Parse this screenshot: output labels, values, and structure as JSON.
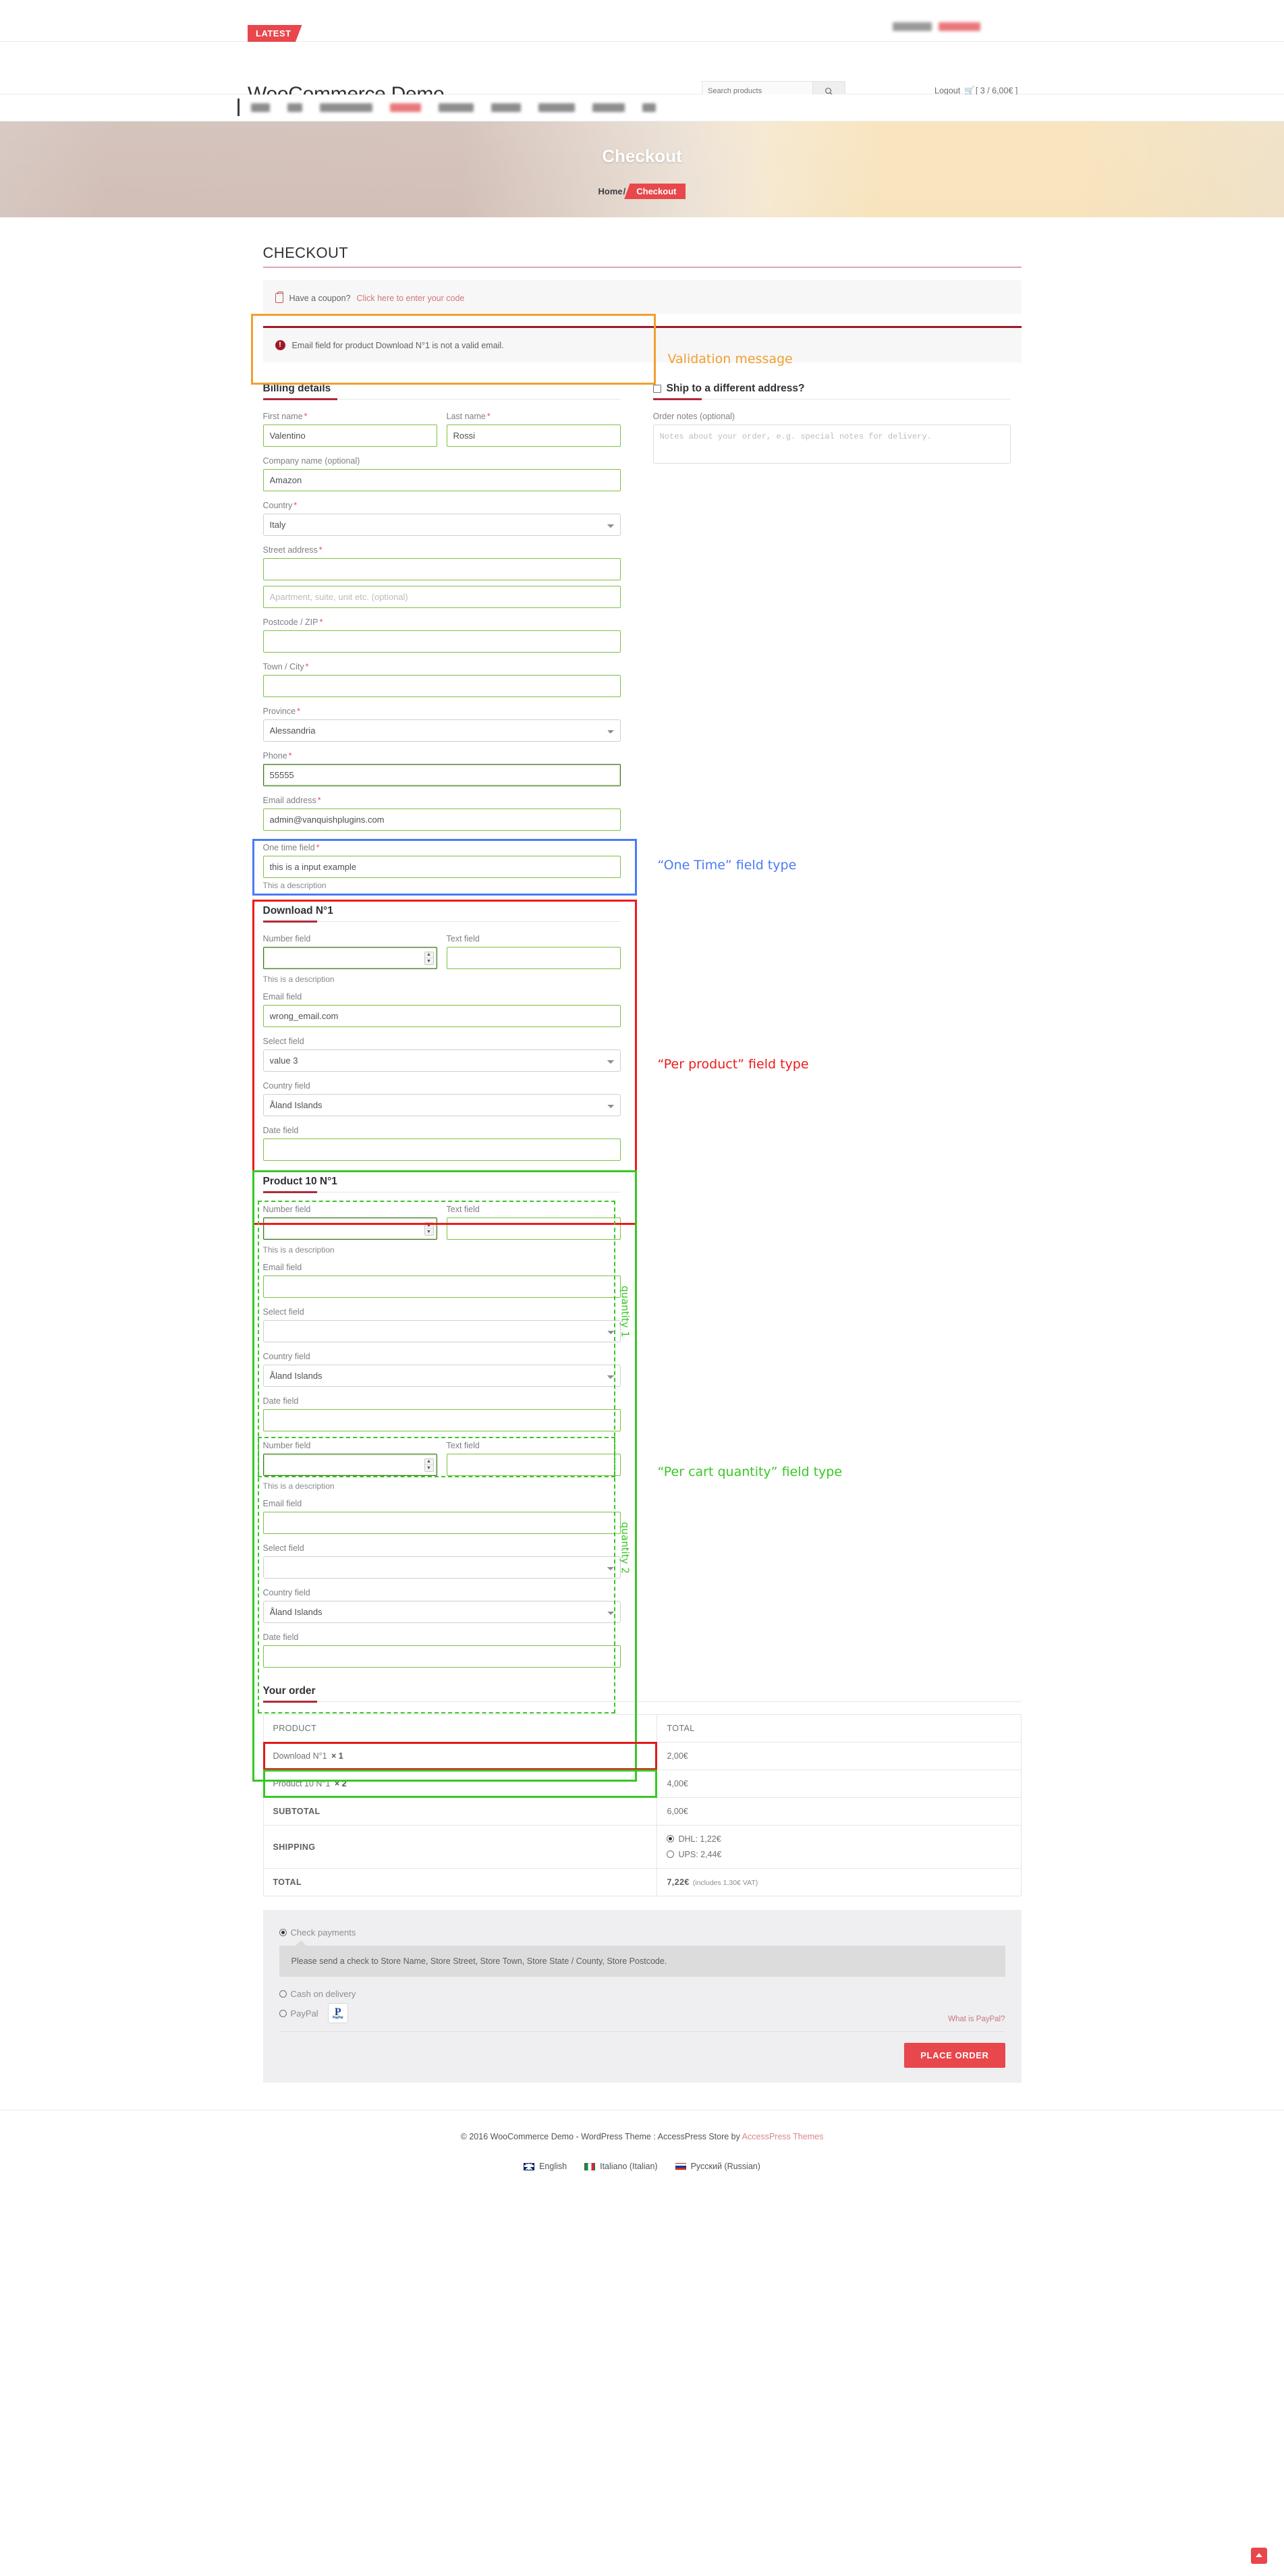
{
  "topbar": {
    "latest_label": "LATEST"
  },
  "header": {
    "site_title": "WooCommerce Demo",
    "search_placeholder": "Search products",
    "logout_label": "Logout",
    "cart_summary": "[ 3 / 6,00€ ]"
  },
  "hero": {
    "title": "Checkout",
    "breadcrumb_home": "Home",
    "breadcrumb_sep": "/",
    "breadcrumb_current": "Checkout"
  },
  "checkout": {
    "page_title": "CHECKOUT",
    "coupon_text": "Have a coupon?",
    "coupon_link": "Click here to enter your code",
    "error_message": "Email field for product Download N°1 is not a valid email."
  },
  "annotations": {
    "validation": {
      "text": "Validation message",
      "color": "#f0a030"
    },
    "one_time": {
      "text": "“One Time” field type",
      "color": "#4a7bf7"
    },
    "per_product": {
      "text": "“Per product” field type",
      "color": "#ef1a1a"
    },
    "per_cart_quantity": {
      "text": "“Per cart quantity” field type",
      "color": "#37c824"
    },
    "quantity_1": "quantity 1",
    "quantity_2": "quantity 2"
  },
  "billing": {
    "title": "Billing details",
    "first_name": {
      "label": "First name",
      "required": true,
      "value": "Valentino"
    },
    "last_name": {
      "label": "Last name",
      "required": true,
      "value": "Rossi"
    },
    "company": {
      "label": "Company name (optional)",
      "value": "Amazon"
    },
    "country": {
      "label": "Country",
      "required": true,
      "value": "Italy"
    },
    "street": {
      "label": "Street address",
      "required": true,
      "value": ""
    },
    "street2": {
      "placeholder": "Apartment, suite, unit etc. (optional)",
      "value": ""
    },
    "postcode": {
      "label": "Postcode / ZIP",
      "required": true,
      "value": ""
    },
    "city": {
      "label": "Town / City",
      "required": true,
      "value": ""
    },
    "province": {
      "label": "Province",
      "required": true,
      "value": "Alessandria"
    },
    "phone": {
      "label": "Phone",
      "required": true,
      "value": "55555"
    },
    "email": {
      "label": "Email address",
      "required": true,
      "value": "admin@vanquishplugins.com"
    },
    "one_time": {
      "label": "One time field",
      "required": true,
      "value": "this is a input example",
      "description": "This a description"
    }
  },
  "shipping": {
    "title": "Ship to a different address?",
    "checked": false,
    "order_notes_label": "Order notes (optional)",
    "order_notes_placeholder": "Notes about your order, e.g. special notes for delivery.",
    "order_notes_value": ""
  },
  "product_sections": [
    {
      "title": "Download N°1",
      "groups": [
        {
          "number_field": {
            "label": "Number field",
            "value": ""
          },
          "text_field": {
            "label": "Text field",
            "value": ""
          },
          "number_description": "This is a description",
          "email_field": {
            "label": "Email field",
            "value": "wrong_email.com"
          },
          "select_field": {
            "label": "Select field",
            "value": "value 3"
          },
          "country_field": {
            "label": "Country field",
            "value": "Åland Islands"
          },
          "date_field": {
            "label": "Date field",
            "value": ""
          }
        }
      ]
    },
    {
      "title": "Product 10 N°1",
      "groups": [
        {
          "number_field": {
            "label": "Number field",
            "value": ""
          },
          "text_field": {
            "label": "Text field",
            "value": ""
          },
          "number_description": "This is a description",
          "email_field": {
            "label": "Email field",
            "value": ""
          },
          "select_field": {
            "label": "Select field",
            "value": ""
          },
          "country_field": {
            "label": "Country field",
            "value": "Åland Islands"
          },
          "date_field": {
            "label": "Date field",
            "value": ""
          }
        },
        {
          "number_field": {
            "label": "Number field",
            "value": ""
          },
          "text_field": {
            "label": "Text field",
            "value": ""
          },
          "number_description": "This is a description",
          "email_field": {
            "label": "Email field",
            "value": ""
          },
          "select_field": {
            "label": "Select field",
            "value": ""
          },
          "country_field": {
            "label": "Country field",
            "value": "Åland Islands"
          },
          "date_field": {
            "label": "Date field",
            "value": ""
          }
        }
      ]
    }
  ],
  "order": {
    "title": "Your order",
    "col_product": "PRODUCT",
    "col_total": "TOTAL",
    "rows": [
      {
        "name": "Download N°1",
        "qty": "× 1",
        "total": "2,00€",
        "highlight": "#e01a1a"
      },
      {
        "name": "Product 10 N°1",
        "qty": "× 2",
        "total": "4,00€",
        "highlight": "#37c824"
      }
    ],
    "subtotal_label": "SUBTOTAL",
    "subtotal_value": "6,00€",
    "shipping_label": "SHIPPING",
    "shipping_options": [
      {
        "label": "DHL: 1,22€",
        "selected": true
      },
      {
        "label": "UPS: 2,44€",
        "selected": false
      }
    ],
    "total_label": "TOTAL",
    "total_value": "7,22€",
    "total_vat": "(includes 1,30€  VAT)"
  },
  "payment": {
    "options": [
      {
        "label": "Check payments",
        "selected": true
      },
      {
        "label": "Cash on delivery",
        "selected": false
      },
      {
        "label": "PayPal",
        "selected": false
      }
    ],
    "check_note": "Please send a check to Store Name, Store Street, Store Town, Store State / County, Store Postcode.",
    "what_is_paypal": "What is PayPal?",
    "paypal_badge_p": "P",
    "paypal_badge_text": "PayPal",
    "place_order_label": "PLACE ORDER"
  },
  "footer": {
    "copyright_prefix": "© 2016 WooCommerce Demo - WordPress Theme : AccessPress Store by ",
    "copyright_link": "AccessPress Themes",
    "languages": [
      {
        "label": "English",
        "flag": "uk"
      },
      {
        "label": "Italiano (Italian)",
        "flag": "it"
      },
      {
        "label": "Русский (Russian)",
        "flag": "ru"
      }
    ]
  }
}
